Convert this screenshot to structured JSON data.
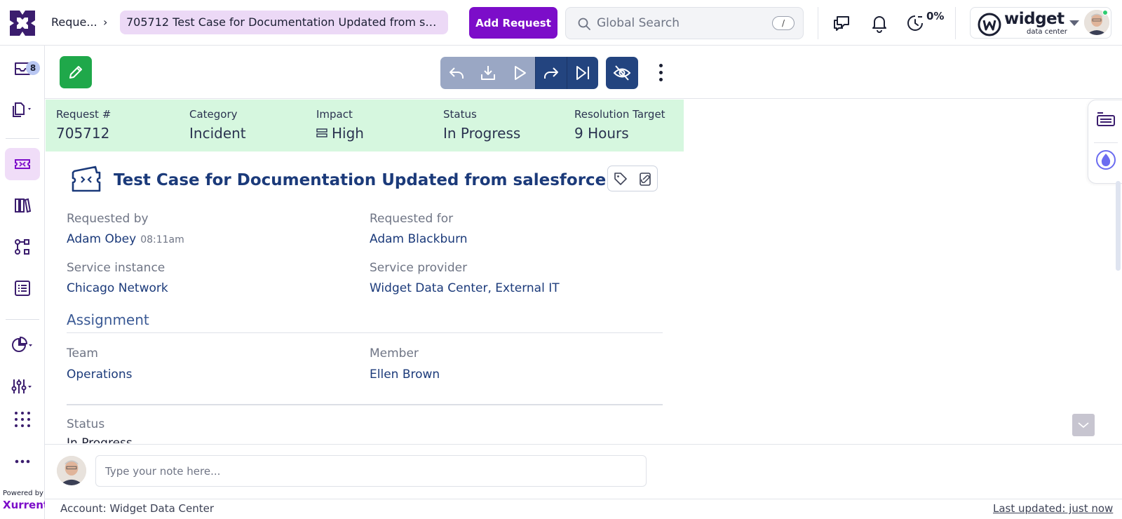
{
  "breadcrumb": {
    "parent": "Reque...",
    "current": "705712  Test Case for Documentation Updated from sa..."
  },
  "header": {
    "add_request_label": "Add Request",
    "search_placeholder": "Global Search",
    "search_shortcut": "/",
    "timer_percent": "0%",
    "account_name": "widget",
    "account_sub": "data center"
  },
  "sidebar": {
    "inbox_badge": "8",
    "powered_by": "Powered by",
    "brand": "Xurrent",
    "items": [
      {
        "name": "inbox-icon"
      },
      {
        "name": "copy-icon"
      },
      {
        "name": "ticket-icon",
        "active": true
      },
      {
        "name": "library-icon"
      },
      {
        "name": "workflow-icon"
      },
      {
        "name": "list-icon"
      },
      {
        "name": "pie-chart-icon"
      },
      {
        "name": "sliders-icon"
      },
      {
        "name": "apps-grid-icon"
      },
      {
        "name": "more-horizontal-icon"
      }
    ]
  },
  "summary": {
    "request_label": "Request #",
    "request_value": "705712",
    "category_label": "Category",
    "category_value": "Incident",
    "impact_label": "Impact",
    "impact_value": "High",
    "status_label": "Status",
    "status_value": "In Progress",
    "target_label": "Resolution Target",
    "target_value": "9 Hours"
  },
  "request": {
    "title": "Test Case for Documentation Updated from salesforce",
    "requested_by_label": "Requested by",
    "requested_by_value": "Adam Obey",
    "requested_by_time": "08:11am",
    "requested_for_label": "Requested for",
    "requested_for_value": "Adam Blackburn",
    "service_instance_label": "Service instance",
    "service_instance_value": "Chicago Network",
    "service_provider_label": "Service provider",
    "service_provider_value": "Widget Data Center, External IT"
  },
  "assignment": {
    "title": "Assignment",
    "team_label": "Team",
    "team_value": "Operations",
    "member_label": "Member",
    "member_value": "Ellen Brown"
  },
  "status_section": {
    "label": "Status",
    "value": "In Progress"
  },
  "note": {
    "placeholder": "Type your note here..."
  },
  "footer": {
    "account": "Account: Widget Data Center",
    "last_updated": "Last updated: just now"
  },
  "colors": {
    "brand_purple": "#7c0dc9",
    "summary_green": "#d6f7df",
    "edit_green": "#1fa84a",
    "action_dark": "#23447f",
    "action_light": "#9aa7c4",
    "link_blue": "#1b3a7a"
  }
}
